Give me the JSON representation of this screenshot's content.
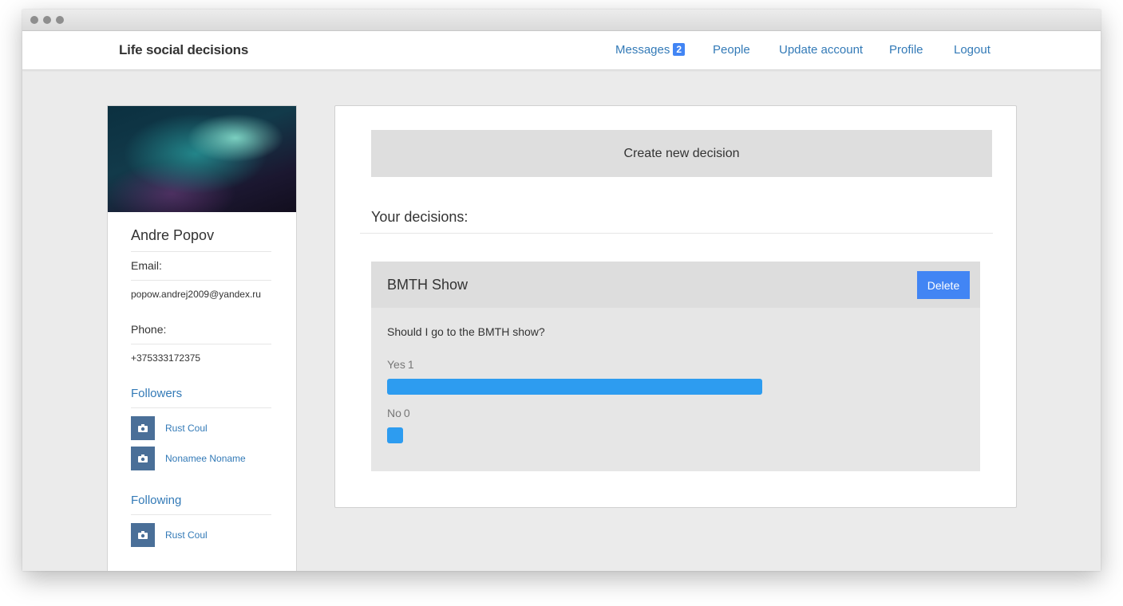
{
  "navbar": {
    "brand": "Life social decisions",
    "links": {
      "messages": "Messages",
      "messages_count": "2",
      "people": "People",
      "update_account": "Update account",
      "profile": "Profile",
      "logout": "Logout"
    }
  },
  "sidebar": {
    "name": "Andre Popov",
    "email_label": "Email:",
    "email": "popow.andrej2009@yandex.ru",
    "phone_label": "Phone:",
    "phone": "+375333172375",
    "followers_label": "Followers",
    "followers": [
      {
        "name": "Rust Coul",
        "icon": "camera-icon"
      },
      {
        "name": "Nonamee Noname",
        "icon": "camera-icon"
      }
    ],
    "following_label": "Following",
    "following": [
      {
        "name": "Rust Coul",
        "icon": "camera-icon"
      }
    ]
  },
  "main": {
    "create_button": "Create new decision",
    "your_decisions": "Your decisions:",
    "decisions": [
      {
        "title": "BMTH Show",
        "delete_label": "Delete",
        "question": "Should I go to the BMTH show?",
        "options": [
          {
            "label": "Yes",
            "count": "1",
            "share": 1.0
          },
          {
            "label": "No",
            "count": "0",
            "share": 0.0
          }
        ]
      }
    ]
  },
  "colors": {
    "accent": "#4285f4",
    "link": "#337ab7",
    "bar": "#2d9cf0",
    "avatar": "#4a6f98"
  }
}
